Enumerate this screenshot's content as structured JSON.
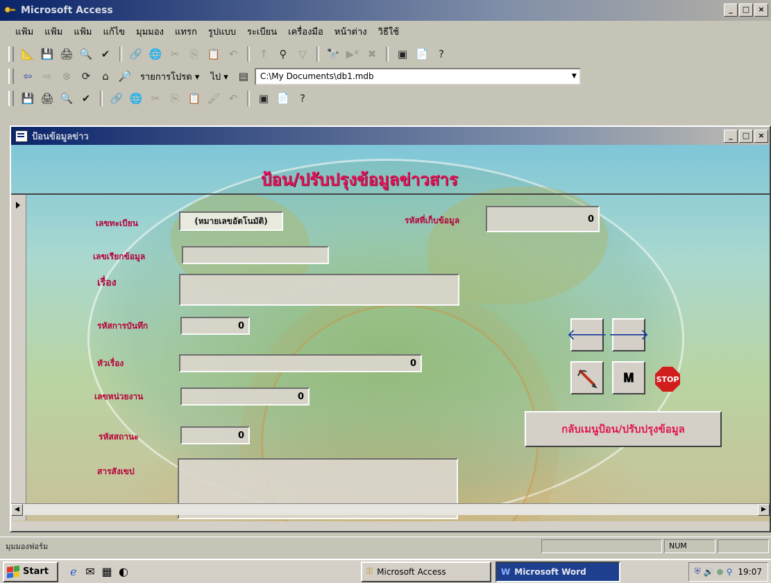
{
  "app": {
    "title": "Microsoft Access"
  },
  "menu": [
    "แฟ้ม",
    "แฟ้ม",
    "แฟ้ม",
    "แก้ไข",
    "มุมมอง",
    "แทรก",
    "รูปแบบ",
    "ระเบียน",
    "เครื่องมือ",
    "หน้าต่าง",
    "วิธีใช้"
  ],
  "webbar": {
    "favorites": "รายการโปรด ▾",
    "go": "ไป ▾",
    "address": "C:\\My Documents\\db1.mdb"
  },
  "form": {
    "window_title": "ป้อนข้อมูลข่าว",
    "heading": "ป้อน/ปรับปรุงข้อมูลข่าวสาร",
    "fields": {
      "reg_no": {
        "label": "เลขทะเบียน",
        "value": "(หมายเลขอัตโนมัติ)"
      },
      "store_code": {
        "label": "รหัสที่เก็บข้อมูล",
        "value": "0"
      },
      "call_no": {
        "label": "เลขเรียกข้อมูล",
        "value": ""
      },
      "title": {
        "label": "เรื่อง",
        "value": ""
      },
      "record_code": {
        "label": "รหัสการบันทึก",
        "value": "0"
      },
      "subject": {
        "label": "หัวเรื่อง",
        "value": "0"
      },
      "unit_no": {
        "label": "เลขหน่วยงาน",
        "value": "0"
      },
      "status_code": {
        "label": "รหัสสถานะ",
        "value": "0"
      },
      "summary": {
        "label": "สารสังเขป",
        "value": ""
      }
    },
    "buttons": {
      "stop": "STOP",
      "back_to_menu": "กลับเมนูป้อน/ปรับปรุงข้อมูล"
    }
  },
  "status": {
    "text": "มุมมองฟอร์ม",
    "num": "NUM"
  },
  "taskbar": {
    "start": "Start",
    "tasks": [
      {
        "label": "Microsoft Access",
        "active": false
      },
      {
        "label": "Microsoft Word",
        "active": true
      }
    ],
    "clock": "19:07"
  },
  "colors": {
    "heading": "#e0155a",
    "label": "#b5003a",
    "titlebar": "#0a246a"
  }
}
